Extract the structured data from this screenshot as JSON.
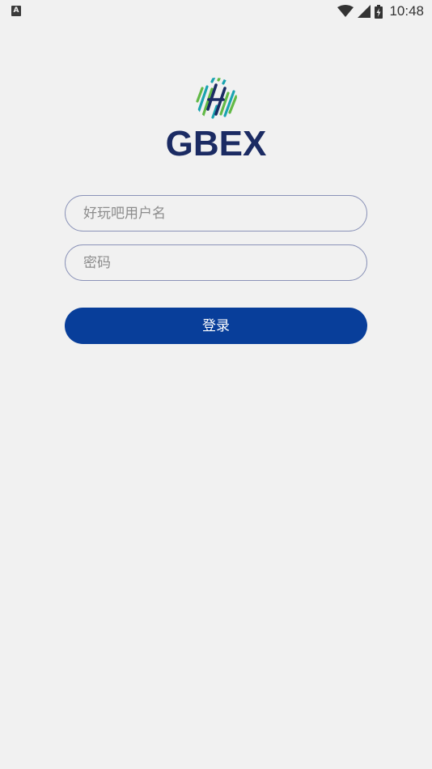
{
  "status_bar": {
    "left_icon_letter": "A",
    "time": "10:48"
  },
  "brand": {
    "name": "GBEX",
    "colors": {
      "text": "#1b2b63",
      "green": "#62b946",
      "teal": "#1aa3b0",
      "navy": "#1b2b63"
    }
  },
  "login_form": {
    "username_placeholder": "好玩吧用户名",
    "password_placeholder": "密码",
    "submit_label": "登录"
  },
  "colors": {
    "background": "#f1f1f1",
    "button": "#083e9a",
    "field_border": "#8b93b8"
  },
  "icons": {
    "status_left": "text-a-notification-icon",
    "wifi": "wifi-icon",
    "signal": "cell-signal-icon",
    "battery": "battery-charging-icon"
  }
}
